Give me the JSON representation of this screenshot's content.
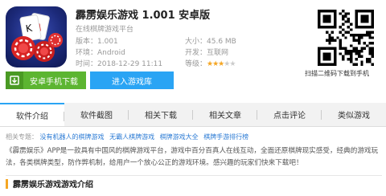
{
  "app": {
    "title": "霹雳娱乐游戏 1.001 安卓版",
    "subtitle": "在线棋牌游戏平台",
    "meta": {
      "version_label": "版本：",
      "version": "1.001",
      "size_label": "大小：",
      "size": "45.6 MB",
      "env_label": "环境：",
      "env": "Android",
      "dev_label": "开发：",
      "dev": "互联网",
      "time_label": "时间：",
      "time": "2018-12-29 11:11",
      "rating_label": "等级：",
      "rating": 3,
      "rating_max": 5
    }
  },
  "buttons": {
    "android": "安卓手机下载",
    "library": "进入游戏库"
  },
  "qr": {
    "label": "扫描二维码下载到手机"
  },
  "tabs": [
    "软件介绍",
    "软件截图",
    "相关下载",
    "相关文章",
    "点击评论",
    "类似游戏"
  ],
  "related": {
    "prefix": "相关专题：",
    "links": [
      "没有机器人的棋牌游戏",
      "无霸人棋牌游戏",
      "棋牌游戏大全",
      "棋牌手游排行榜"
    ]
  },
  "description": "《霹雳娱乐》APP是一款具有中国风的棋牌游戏平台，游戏中百分百真人在线互动，全面还原棋牌现实感受，经典的游戏玩法，各类棋牌类型，防作弊机制，给用户一个放心公正的游戏环境。感兴趣的玩家们快来下载吧！",
  "section_title": "霹雳娱乐游戏游戏介绍",
  "colors": {
    "accent_green": "#5cb531",
    "accent_blue": "#2aa4f4",
    "star": "#f5a623"
  }
}
